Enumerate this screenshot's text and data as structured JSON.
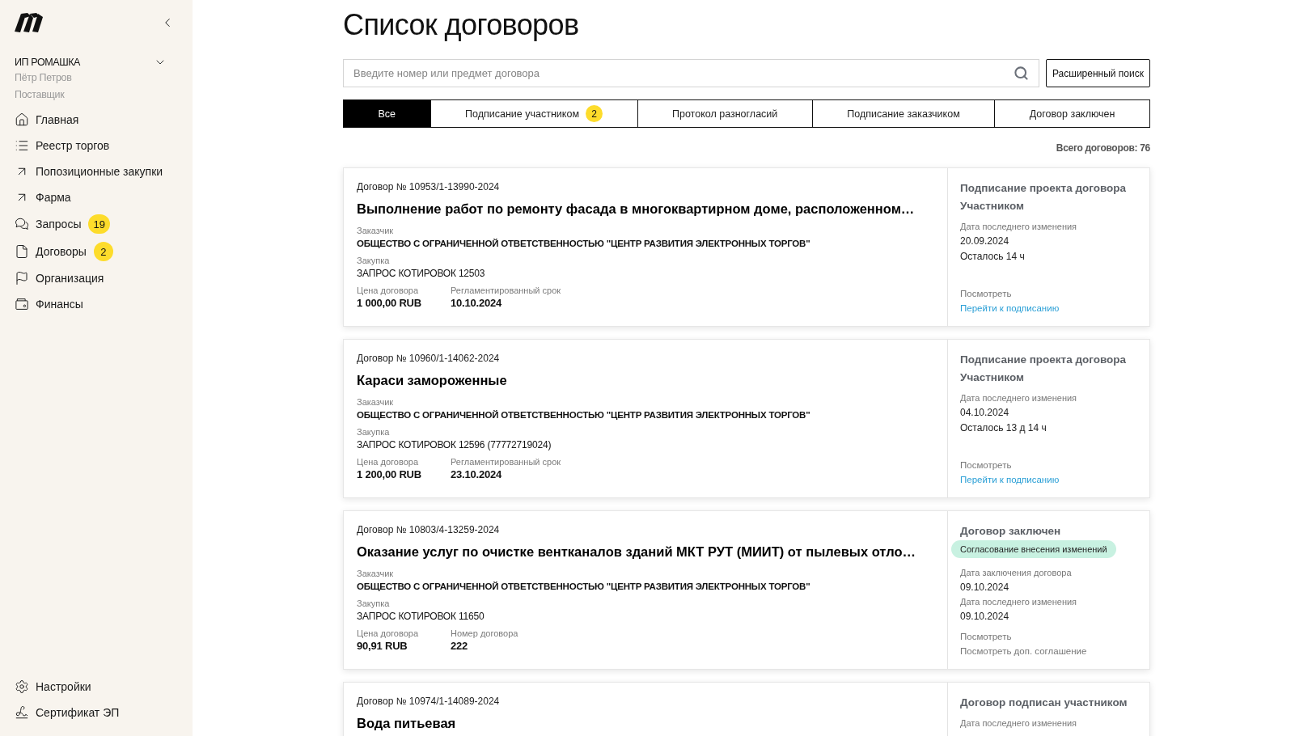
{
  "sidebar": {
    "account": {
      "organization": "ИП РОМАШКА",
      "user": "Пётр Петров",
      "role": "Поставщик"
    },
    "nav": [
      {
        "label": "Главная"
      },
      {
        "label": "Реестр торгов"
      },
      {
        "label": "Попозиционные закупки"
      },
      {
        "label": "Фарма"
      },
      {
        "label": "Запросы",
        "badge": "19"
      },
      {
        "label": "Договоры",
        "badge": "2"
      },
      {
        "label": "Организация"
      },
      {
        "label": "Финансы"
      }
    ],
    "footer_nav": [
      {
        "label": "Настройки"
      },
      {
        "label": "Сертификат ЭП"
      }
    ]
  },
  "page": {
    "title": "Список договоров",
    "search": {
      "placeholder": "Введите номер или предмет договора"
    },
    "advanced_search": "Расширенный поиск",
    "tabs": [
      {
        "label": "Все",
        "selected": true
      },
      {
        "label": "Подписание участником",
        "selected": false,
        "badge": "2"
      },
      {
        "label": "Протокол разногласий",
        "selected": false
      },
      {
        "label": "Подписание заказчиком",
        "selected": false
      },
      {
        "label": "Договор заключен",
        "selected": false
      }
    ],
    "total": "Всего договоров: 76",
    "contracts": [
      {
        "number": "Договор № 10953/1-13990-2024",
        "title": "Выполнение работ по ремонту фасада в многоквартирном доме, расположенном…",
        "details": [
          {
            "kind": "customer",
            "label": "Заказчик",
            "value": "ОБЩЕСТВО С ОГРАНИЧЕННОЙ ОТВЕТСТВЕННОСТЬЮ \"ЦЕНТР РАЗВИТИЯ ЭЛЕКТРОННЫХ ТОРГОВ\""
          },
          {
            "kind": "purchase",
            "label": "Закупка",
            "value": "ЗАПРОС КОТИРОВОК 12503"
          }
        ],
        "fields": [
          {
            "label": "Цена договора",
            "value": "1 000,00 RUB"
          },
          {
            "label": "Регламентированный срок",
            "value": "10.10.2024"
          }
        ],
        "status": {
          "title": "Подписание проекта договора Участником",
          "lines": [
            {
              "kind": "label",
              "text": "Дата последнего изменения"
            },
            {
              "kind": "value",
              "text": "20.09.2024"
            },
            {
              "kind": "value",
              "text": "Осталось 14 ч"
            }
          ],
          "actions": [
            {
              "kind": "plain",
              "label": "Посмотреть"
            },
            {
              "kind": "link",
              "label": "Перейти к подписанию"
            }
          ]
        }
      },
      {
        "number": "Договор № 10960/1-14062-2024",
        "title": "Караси замороженные",
        "details": [
          {
            "kind": "customer",
            "label": "Заказчик",
            "value": "ОБЩЕСТВО С ОГРАНИЧЕННОЙ ОТВЕТСТВЕННОСТЬЮ \"ЦЕНТР РАЗВИТИЯ ЭЛЕКТРОННЫХ ТОРГОВ\""
          },
          {
            "kind": "purchase",
            "label": "Закупка",
            "value": "ЗАПРОС КОТИРОВОК 12596 (77772719024)"
          }
        ],
        "fields": [
          {
            "label": "Цена договора",
            "value": "1 200,00 RUB"
          },
          {
            "label": "Регламентированный срок",
            "value": "23.10.2024"
          }
        ],
        "status": {
          "title": "Подписание проекта договора Участником",
          "lines": [
            {
              "kind": "label",
              "text": "Дата последнего изменения"
            },
            {
              "kind": "value",
              "text": "04.10.2024"
            },
            {
              "kind": "value",
              "text": "Осталось 13 д 14 ч"
            }
          ],
          "actions": [
            {
              "kind": "plain",
              "label": "Посмотреть"
            },
            {
              "kind": "link",
              "label": "Перейти к подписанию"
            }
          ]
        }
      },
      {
        "number": "Договор № 10803/4-13259-2024",
        "title": "Оказание услуг по очистке вентканалов зданий МКТ РУТ (МИИТ) от пылевых отло…",
        "details": [
          {
            "kind": "customer",
            "label": "Заказчик",
            "value": "ОБЩЕСТВО С ОГРАНИЧЕННОЙ ОТВЕТСТВЕННОСТЬЮ \"ЦЕНТР РАЗВИТИЯ ЭЛЕКТРОННЫХ ТОРГОВ\""
          },
          {
            "kind": "purchase",
            "label": "Закупка",
            "value": "ЗАПРОС КОТИРОВОК 11650"
          }
        ],
        "fields": [
          {
            "label": "Цена договора",
            "value": "90,91 RUB"
          },
          {
            "label": "Номер договора",
            "value": "222"
          }
        ],
        "status": {
          "title": "Договор заключен",
          "tag": "Согласование внесения изменений",
          "lines": [
            {
              "kind": "label",
              "text": "Дата заключения договора"
            },
            {
              "kind": "value",
              "text": "09.10.2024"
            },
            {
              "kind": "label",
              "text": "Дата последнего изменения"
            },
            {
              "kind": "value",
              "text": "09.10.2024"
            }
          ],
          "actions": [
            {
              "kind": "plain",
              "label": "Посмотреть"
            },
            {
              "kind": "plain",
              "label": "Посмотреть доп. соглашение"
            }
          ]
        }
      },
      {
        "number": "Договор № 10974/1-14089-2024",
        "title": "Вода питьевая",
        "status": {
          "title": "Договор подписан участником",
          "lines": [
            {
              "kind": "label",
              "text": "Дата последнего изменения"
            }
          ]
        }
      }
    ]
  }
}
